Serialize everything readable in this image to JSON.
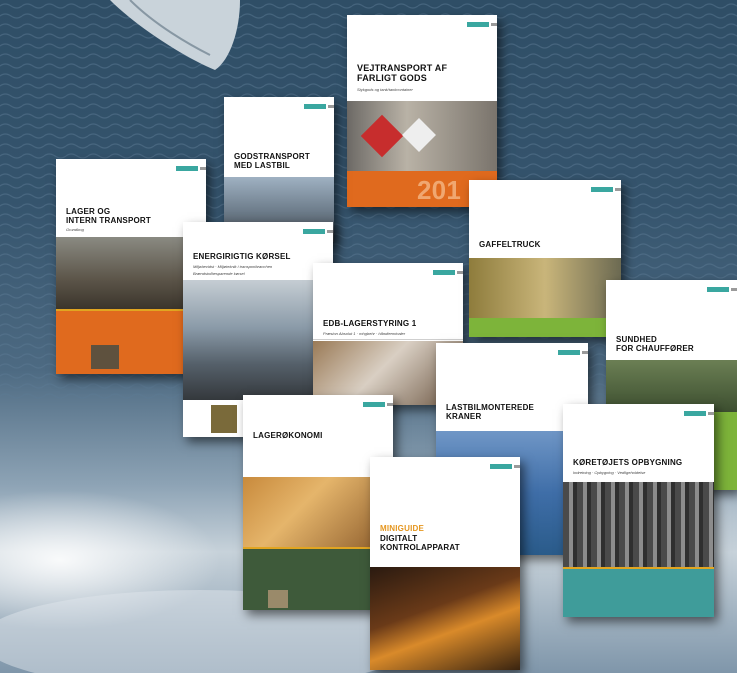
{
  "books": {
    "vejtransport": {
      "title": "VEJTRANSPORT AF\nFARLIGT GODS",
      "subtitle": "Stykgods og tank/tankcontainer",
      "big": "201"
    },
    "godstransport": {
      "title": "GODSTRANSPORT\nMED LASTBIL"
    },
    "lager": {
      "title": "LAGER OG\nINTERN TRANSPORT",
      "subtitle": "Grundbog"
    },
    "energi": {
      "title": "ENERGIRIGTIG KØRSEL",
      "subtitle": "Miljøbevidst · Miljøteknik i transportbranchen",
      "subtitle2": "Brændstofbesparende kørsel"
    },
    "edb": {
      "title": "EDB-LAGERSTYRING 1",
      "subtitle": "Præsion Absolut 1 · mhgbehr · håndterminaler"
    },
    "gaffeltruck": {
      "title": "GAFFELTRUCK"
    },
    "sundhed": {
      "title": "SUNDHED\nFOR CHAUFFØRER"
    },
    "lastbilkran": {
      "title": "LASTBILMONTEREDE\nKRANER"
    },
    "lagerokonomi": {
      "title": "LAGERØKONOMI"
    },
    "koretojet": {
      "title": "KØRETØJETS OPBYGNING",
      "subtitle": "Indretning · Opbygning · Vedligeholdelse"
    },
    "miniguide": {
      "kicker": "MINIGUIDE",
      "title": "DIGITALT\nKONTROLAPPARAT"
    }
  },
  "colors": {
    "orange": "#e06a1e",
    "green_light": "#7db43a",
    "green_dark": "#3e5a3a",
    "teal": "#3f9c9a",
    "blue_band": "#2a5b8a",
    "gold_line": "#e1a521",
    "logo": "#3aa7a0"
  }
}
